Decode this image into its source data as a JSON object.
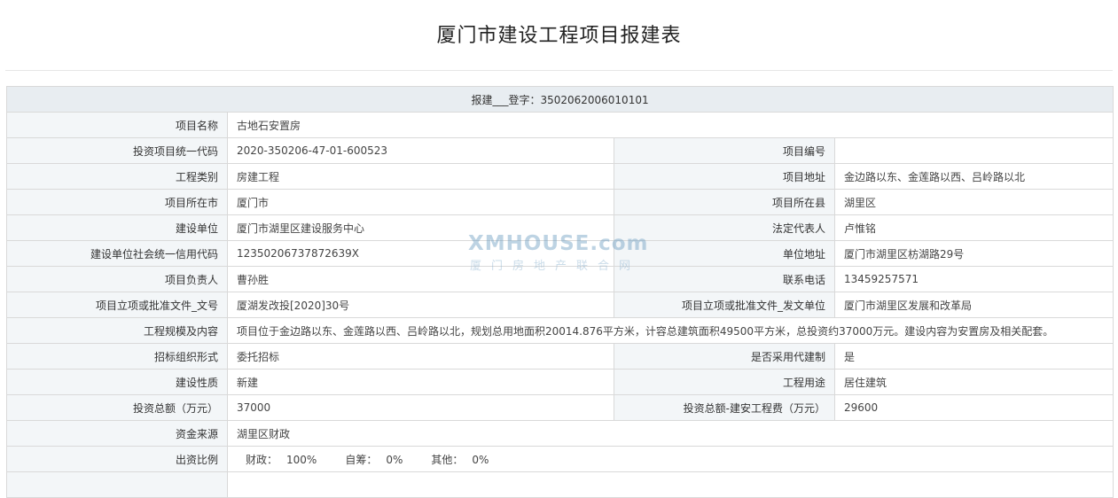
{
  "page": {
    "title": "厦门市建设工程项目报建表"
  },
  "header_row": "报建___登字：3502062006010101",
  "fields": {
    "project_name": {
      "label": "项目名称",
      "value": "古地石安置房"
    },
    "invest_code": {
      "label": "投资项目统一代码",
      "value": "2020-350206-47-01-600523"
    },
    "project_no": {
      "label": "项目编号",
      "value": ""
    },
    "eng_type": {
      "label": "工程类别",
      "value": "房建工程"
    },
    "address": {
      "label": "项目地址",
      "value": "金边路以东、金莲路以西、吕岭路以北"
    },
    "city": {
      "label": "项目所在市",
      "value": "厦门市"
    },
    "county": {
      "label": "项目所在县",
      "value": "湖里区"
    },
    "builder": {
      "label": "建设单位",
      "value": "厦门市湖里区建设服务中心"
    },
    "legal_rep": {
      "label": "法定代表人",
      "value": "卢惟铭"
    },
    "credit_code": {
      "label": "建设单位社会统一信用代码",
      "value": "12350206737872639X"
    },
    "unit_address": {
      "label": "单位地址",
      "value": "厦门市湖里区枋湖路29号"
    },
    "manager": {
      "label": "项目负责人",
      "value": "曹孙胜"
    },
    "phone": {
      "label": "联系电话",
      "value": "13459257571"
    },
    "approval_doc": {
      "label": "项目立项或批准文件_文号",
      "value": "厦湖发改投[2020]30号"
    },
    "approval_unit": {
      "label": "项目立项或批准文件_发文单位",
      "value": "厦门市湖里区发展和改革局"
    },
    "scale": {
      "label": "工程规模及内容",
      "value": "项目位于金边路以东、金莲路以西、吕岭路以北，规划总用地面积20014.876平方米，计容总建筑面积49500平方米，总投资约37000万元。建设内容为安置房及相关配套。"
    },
    "bidding": {
      "label": "招标组织形式",
      "value": "委托招标"
    },
    "agent_system": {
      "label": "是否采用代建制",
      "value": "是"
    },
    "nature": {
      "label": "建设性质",
      "value": "新建"
    },
    "usage": {
      "label": "工程用途",
      "value": "居住建筑"
    },
    "total_invest": {
      "label": "投资总额（万元）",
      "value": "37000"
    },
    "install_cost": {
      "label": "投资总额-建安工程费（万元）",
      "value": "29600"
    },
    "fund_source": {
      "label": "资金来源",
      "value": "湖里区财政"
    },
    "ratio": {
      "label": "出资比例",
      "fiscal_label": "财政：",
      "fiscal_value": "100%",
      "self_label": "自筹：",
      "self_value": "0%",
      "other_label": "其他：",
      "other_value": "0%"
    }
  },
  "watermark": {
    "logo": "XMHOUSE.com",
    "subtitle": "厦门房地产联合网"
  }
}
